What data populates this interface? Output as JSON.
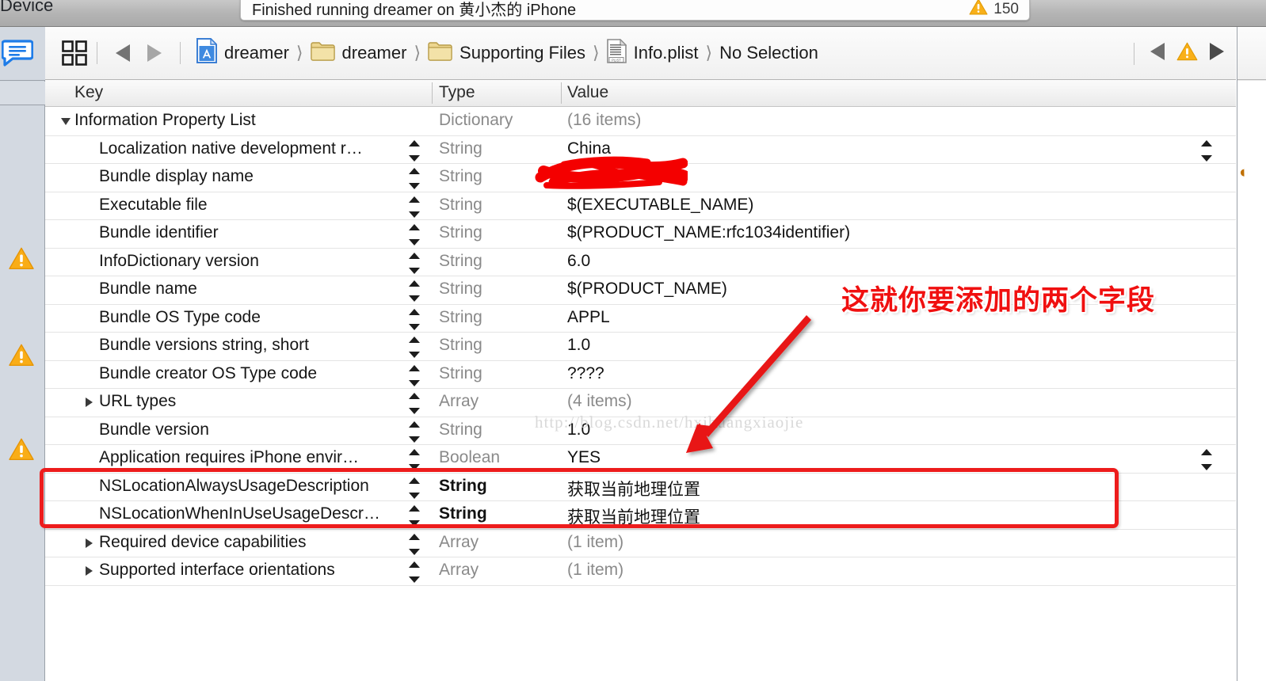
{
  "window": {
    "device_label": "Device",
    "activity": {
      "status_text": "Finished running dreamer on 黄小杰的 iPhone",
      "warning_icon": "warning-triangle-icon",
      "warning_count": "150"
    }
  },
  "left_gutter": {
    "comment_icon": "comment-bubble-icon",
    "warning_icon": "warning-triangle-icon",
    "warning_markers": 3
  },
  "jumpbar": {
    "related_items_icon": "related-items-grid-icon",
    "back_icon": "back-triangle-icon",
    "forward_icon": "forward-triangle-icon",
    "breadcrumbs": [
      {
        "label": "dreamer",
        "icon": "xcode-project-icon"
      },
      {
        "label": "dreamer",
        "icon": "folder-icon"
      },
      {
        "label": "Supporting Files",
        "icon": "folder-icon"
      },
      {
        "label": "Info.plist",
        "icon": "plist-file-icon"
      },
      {
        "label": "No Selection",
        "icon": ""
      }
    ],
    "issue_prev_icon": "previous-issue-icon",
    "issue_warning_icon": "warning-triangle-icon",
    "issue_next_icon": "next-issue-icon"
  },
  "plist_table": {
    "columns": [
      "Key",
      "Type",
      "Value"
    ],
    "rows": [
      {
        "indent": 0,
        "disclosure": "open",
        "key": "Information Property List",
        "type": "Dictionary",
        "value": "(16 items)",
        "value_muted": true,
        "type_muted": true,
        "stepper": false,
        "right_stepper": false,
        "highlight": false
      },
      {
        "indent": 1,
        "disclosure": "none",
        "key": "Localization native development r…",
        "type": "String",
        "value": "China",
        "value_muted": false,
        "type_muted": true,
        "stepper": true,
        "right_stepper": true,
        "highlight": false
      },
      {
        "indent": 1,
        "disclosure": "none",
        "key": "Bundle display name",
        "type": "String",
        "value": "",
        "value_muted": false,
        "type_muted": true,
        "stepper": true,
        "right_stepper": false,
        "highlight": false
      },
      {
        "indent": 1,
        "disclosure": "none",
        "key": "Executable file",
        "type": "String",
        "value": "$(EXECUTABLE_NAME)",
        "value_muted": false,
        "type_muted": true,
        "stepper": true,
        "right_stepper": false,
        "highlight": false
      },
      {
        "indent": 1,
        "disclosure": "none",
        "key": "Bundle identifier",
        "type": "String",
        "value": "$(PRODUCT_NAME:rfc1034identifier)",
        "value_muted": false,
        "type_muted": true,
        "stepper": true,
        "right_stepper": false,
        "highlight": false
      },
      {
        "indent": 1,
        "disclosure": "none",
        "key": "InfoDictionary version",
        "type": "String",
        "value": "6.0",
        "value_muted": false,
        "type_muted": true,
        "stepper": true,
        "right_stepper": false,
        "highlight": false
      },
      {
        "indent": 1,
        "disclosure": "none",
        "key": "Bundle name",
        "type": "String",
        "value": "$(PRODUCT_NAME)",
        "value_muted": false,
        "type_muted": true,
        "stepper": true,
        "right_stepper": false,
        "highlight": false
      },
      {
        "indent": 1,
        "disclosure": "none",
        "key": "Bundle OS Type code",
        "type": "String",
        "value": "APPL",
        "value_muted": false,
        "type_muted": true,
        "stepper": true,
        "right_stepper": false,
        "highlight": false
      },
      {
        "indent": 1,
        "disclosure": "none",
        "key": "Bundle versions string, short",
        "type": "String",
        "value": "1.0",
        "value_muted": false,
        "type_muted": true,
        "stepper": true,
        "right_stepper": false,
        "highlight": false
      },
      {
        "indent": 1,
        "disclosure": "none",
        "key": "Bundle creator OS Type code",
        "type": "String",
        "value": "????",
        "value_muted": false,
        "type_muted": true,
        "stepper": true,
        "right_stepper": false,
        "highlight": false
      },
      {
        "indent": 1,
        "disclosure": "closed",
        "key": "URL types",
        "type": "Array",
        "value": "(4 items)",
        "value_muted": true,
        "type_muted": true,
        "stepper": true,
        "right_stepper": false,
        "highlight": false
      },
      {
        "indent": 1,
        "disclosure": "none",
        "key": "Bundle version",
        "type": "String",
        "value": "1.0",
        "value_muted": false,
        "type_muted": true,
        "stepper": true,
        "right_stepper": false,
        "highlight": false
      },
      {
        "indent": 1,
        "disclosure": "none",
        "key": "Application requires iPhone envir…",
        "type": "Boolean",
        "value": "YES",
        "value_muted": false,
        "type_muted": true,
        "stepper": true,
        "right_stepper": true,
        "highlight": false
      },
      {
        "indent": 1,
        "disclosure": "none",
        "key": "NSLocationAlwaysUsageDescription",
        "type": "String",
        "value": "获取当前地理位置",
        "value_muted": false,
        "type_muted": false,
        "stepper": true,
        "right_stepper": false,
        "highlight": true
      },
      {
        "indent": 1,
        "disclosure": "none",
        "key": "NSLocationWhenInUseUsageDescr…",
        "type": "String",
        "value": "获取当前地理位置",
        "value_muted": false,
        "type_muted": false,
        "stepper": true,
        "right_stepper": false,
        "highlight": true
      },
      {
        "indent": 1,
        "disclosure": "closed",
        "key": "Required device capabilities",
        "type": "Array",
        "value": "(1 item)",
        "value_muted": true,
        "type_muted": true,
        "stepper": true,
        "right_stepper": false,
        "highlight": false
      },
      {
        "indent": 1,
        "disclosure": "closed",
        "key": "Supported interface orientations",
        "type": "Array",
        "value": "(1 item)",
        "value_muted": true,
        "type_muted": true,
        "stepper": true,
        "right_stepper": false,
        "highlight": false
      }
    ]
  },
  "annotations": {
    "callout_text": "这就你要添加的两个字段",
    "callout_color": "#f01010",
    "arrow_color": "#e81515",
    "highlight_box_color": "#ed1c1c",
    "redaction_color": "#f00000",
    "watermark_text": "http://blog.csdn.net/hxjhuangxiaojie"
  }
}
